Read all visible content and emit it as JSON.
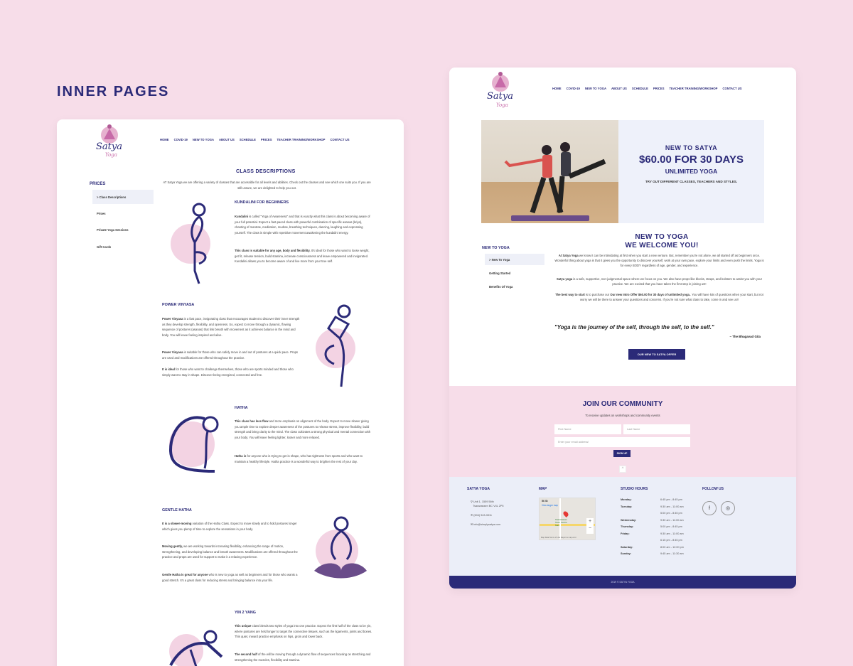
{
  "heading": "INNER PAGES",
  "brand": {
    "logo": "Satya",
    "logo_sub": "Yoga"
  },
  "nav": [
    "HOME",
    "COVID-19",
    "NEW TO YOGA",
    "ABOUT US",
    "SCHEDULE",
    "PRICES",
    "TEACHER TRAINING/WORKSHOP",
    "CONTACT US"
  ],
  "left_page": {
    "sidebar_title": "PRICES",
    "sidebar_items": [
      "> Class Descriptions",
      "Prices",
      "Private Yoga Sessions",
      "Gift Cards"
    ],
    "title": "CLASS DESCRIPTIONS",
    "intro": "AT Satya Yoga we are offering a variety of classes that are accessible for all levels and abilities. Check out the classes and see which one suits you.  If you are still unsure, we are delighted to help you out.",
    "classes": [
      {
        "name": "KUNDALINI FOR BEGINNERS",
        "p1_b": "Kundalini",
        "p1": " is called \"Yoga of Awareness\" and that is exactly what this class is about becoming aware of your full potential.  Expect a fast-paced class with powerful combination of specific asanas (kriya), chanting of mantras, meditation, mudras, breathing techniques, dancing, laughing and expressing yourself. The class is simple with repetitive movement awakening the kundalini energy.",
        "p2_b": "This class is suitable for any age, body and flexibility.",
        "p2": " It's ideal for those who want to loose weight, get fit, release tension, build stamina, increase consciousness and leave empowered and invigorated. Kundalini allows you to become aware of and live more from your true self."
      },
      {
        "name": "POWER VINYASA",
        "p1_b": "Power Vinyasa",
        "p1": " is a fast pace, invigorating class that encourages student to discover their inner strength as they develop strength, flexibility, and openness. So, expect to move through a dynamic, flowing sequence of postures (asanas) that link breath with movement as it achieves balance in the mind and body. You will leave feeling inspired and alive.",
        "p2_b": "Power Vinyasa",
        "p2": " is suitable for those who can safely move in and out of postures at a quick pace. Props are used and modifications are offered throughout the practice.",
        "p3_b": "It is ideal",
        "p3": " for those who want to challenge themselves, those who are sports minded and those who simply want to stay in shape. Discover being energized, connected and free."
      },
      {
        "name": "HATHA",
        "p1_b": "This class has less flow",
        "p1": " and more emphasis on alignment of the body. Expect to move slower giving you ample time to explore deeper awareness of the postures to release stress, improve flexibility, build strength and bring clarity to the mind. The class cultivates a strong physical and mental connection with your body. You will leave feeling lighter, looser and more relaxed.",
        "p2_b": "Hatha is",
        "p2": " for anyone who is trying to get in shape, who has tightness from sports and who want to maintain a healthy lifestyle. Hatha practice is a wonderful way to brighten the rest of your day."
      },
      {
        "name": "GENTLE HATHA",
        "p1_b": "It is a slower-moving",
        "p1": " variation of the Hatha Class.  Expect to move slowly and to hold postures longer which gives you plenty of time to explore the sensations in your body.",
        "p2_b": "Moving gently,",
        "p2": " we are working towards increasing flexibility, enhancing the range of motion, strengthening, and developing balance and breath awareness. Modifications are offered throughout the practice and props are used for support to make it a relaxing experience.",
        "p3_b": "Gentle Hatha is great for anyone",
        "p3": " who is new to yoga as well as beginners and for those who wants a good stretch. It's a great class for reducing stress and bringing balance into your life."
      },
      {
        "name": "YIN 2 YANG",
        "p1_b": "This unique",
        "p1": " class blends two styles of yoga into one practice. Expect the first half of the class to be yin, where postures are held longer to target the connective tissues, such as the ligaments, joints and bones. This quiet, inward practice emphasis on hips, groin and lower back.",
        "p2_b": "The second half",
        "p2": " of the will be moving through a dynamic flow of sequences focusing on stretching and strengthening the muscles, flexibility and stamina."
      }
    ]
  },
  "right_page": {
    "hero": {
      "l1": "NEW TO SATYA",
      "l2": "$60.00 FOR 30 DAYS",
      "l3": "UNLIMITED YOGA",
      "l4": "TRY OUT DIFFERENT CLASSES, TEACHERS AND STYLES."
    },
    "title1": "NEW TO YOGA",
    "title2": "WE WELCOME YOU!",
    "sidebar_title": "NEW TO YOGA",
    "sidebar_items": [
      "> New To Yoga",
      "Getting Started",
      "Benefits Of Yoga"
    ],
    "p1_b": "At Satya Yoga",
    "p1": " we know it can be intimidating at first when you start a new venture. But, remember you're not alone, we all started off as beginners once. Wonderful thing about yoga is that it gives you the opportunity to discover yourself, work at your own pace, explore your limits and even push the limits. Yoga is for every BODY regardless of age, gender, and experience.",
    "p2_b": "Satya yoga",
    "p2": " is a safe, supportive, non-judgmental space where we focus on you. We also have props like blocks, straps, and bolsters to assist you with your practice. We are excited that you have taken the first step in joining us!!",
    "p3_b": "The best way to start",
    "p3a": " is to purchase our ",
    "p3_b2": "Our new Intro Offer $60.00 for 30 days of unlimited yoga.",
    "p3": ".  You will have lots of questions when your start, but not worry we will be there to answer your questions and concerns. If you're not sure what class to take, come in and see us!!",
    "quote": "\"Yoga is the journey of the self, through the self, to the self.\"",
    "quote_author": "~ The Bhagavad Gita",
    "offer_button": "OUR NEW TO SATYA OFFER",
    "community": {
      "title": "JOIN OUR COMMUNITY",
      "subtitle": "To receive updates on workshops and community events",
      "first": "First Name",
      "last": "Last Name",
      "email": "Enter your email address!",
      "signup": "SIGN UP"
    },
    "footer": {
      "col1": "SATYA YOGA",
      "address1": "Unit 1, 1559 56th",
      "address2": "Tsawwassen BC V4L 2P5",
      "phone": "(604) 943-3311",
      "email": "info@simplysatya.com",
      "col2": "MAP",
      "map_label": "56 St",
      "map_link": "View larger map",
      "map_place": "Tsawwassen Town Centre Mall",
      "map_credit": "Map Data  Terms of Use  Report a map error",
      "col3": "STUDIO HOURS",
      "hours": [
        [
          "Monday:",
          "6:45 pm - 8:45 pm"
        ],
        [
          "Tuesday:",
          "9:30 am - 11:00 am"
        ],
        [
          "",
          "5:00 pm - 8:45 pm"
        ],
        [
          "Wednesday:",
          "9:30 am - 11:00 am"
        ],
        [
          "Thursday:",
          "5:00 pm - 8:45 pm"
        ],
        [
          "Friday:",
          "9:30 am - 11:00 am"
        ],
        [
          "",
          "6:15 pm - 8:45 pm"
        ],
        [
          "Saturday:",
          "8:00 am - 12:00 pm"
        ],
        [
          "Sunday:",
          "9:45 am - 11:30 am"
        ]
      ],
      "col4": "FOLLOW US",
      "copyright": "2019 © SATYA YOGA"
    }
  }
}
